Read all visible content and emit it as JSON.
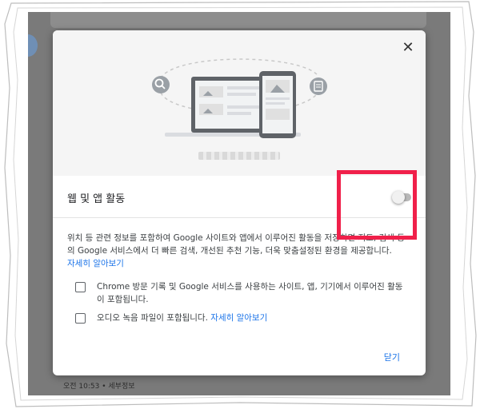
{
  "dialog": {
    "setting_title": "웹 및 앱 활동",
    "description": "위치 등 관련 정보를 포함하여 Google 사이트와 앱에서 이루어진 활동을 저장하면 지도, 검색 등의 Google 서비스에서 더 빠른 검색, 개선된 추천 기능, 더욱 맞춤설정된 환경을 제공합니다.",
    "learn_more": "자세히 알아보기",
    "checkbox_chrome": "Chrome 방문 기록 및 Google 서비스를 사용하는 사이트, 앱, 기기에서 이루어진 활동이 포함됩니다.",
    "checkbox_audio": "오디오 녹음 파일이 포함됩니다.",
    "checkbox_audio_link": "자세히 알아보기",
    "close_label": "닫기",
    "close_icon": "close-icon",
    "toggle_on": false
  },
  "background": {
    "footer_text": "오전 10:53 • 세부정보"
  },
  "colors": {
    "link": "#1a73e8",
    "highlight": "#f0204a",
    "overlay": "#7a7a7a"
  }
}
